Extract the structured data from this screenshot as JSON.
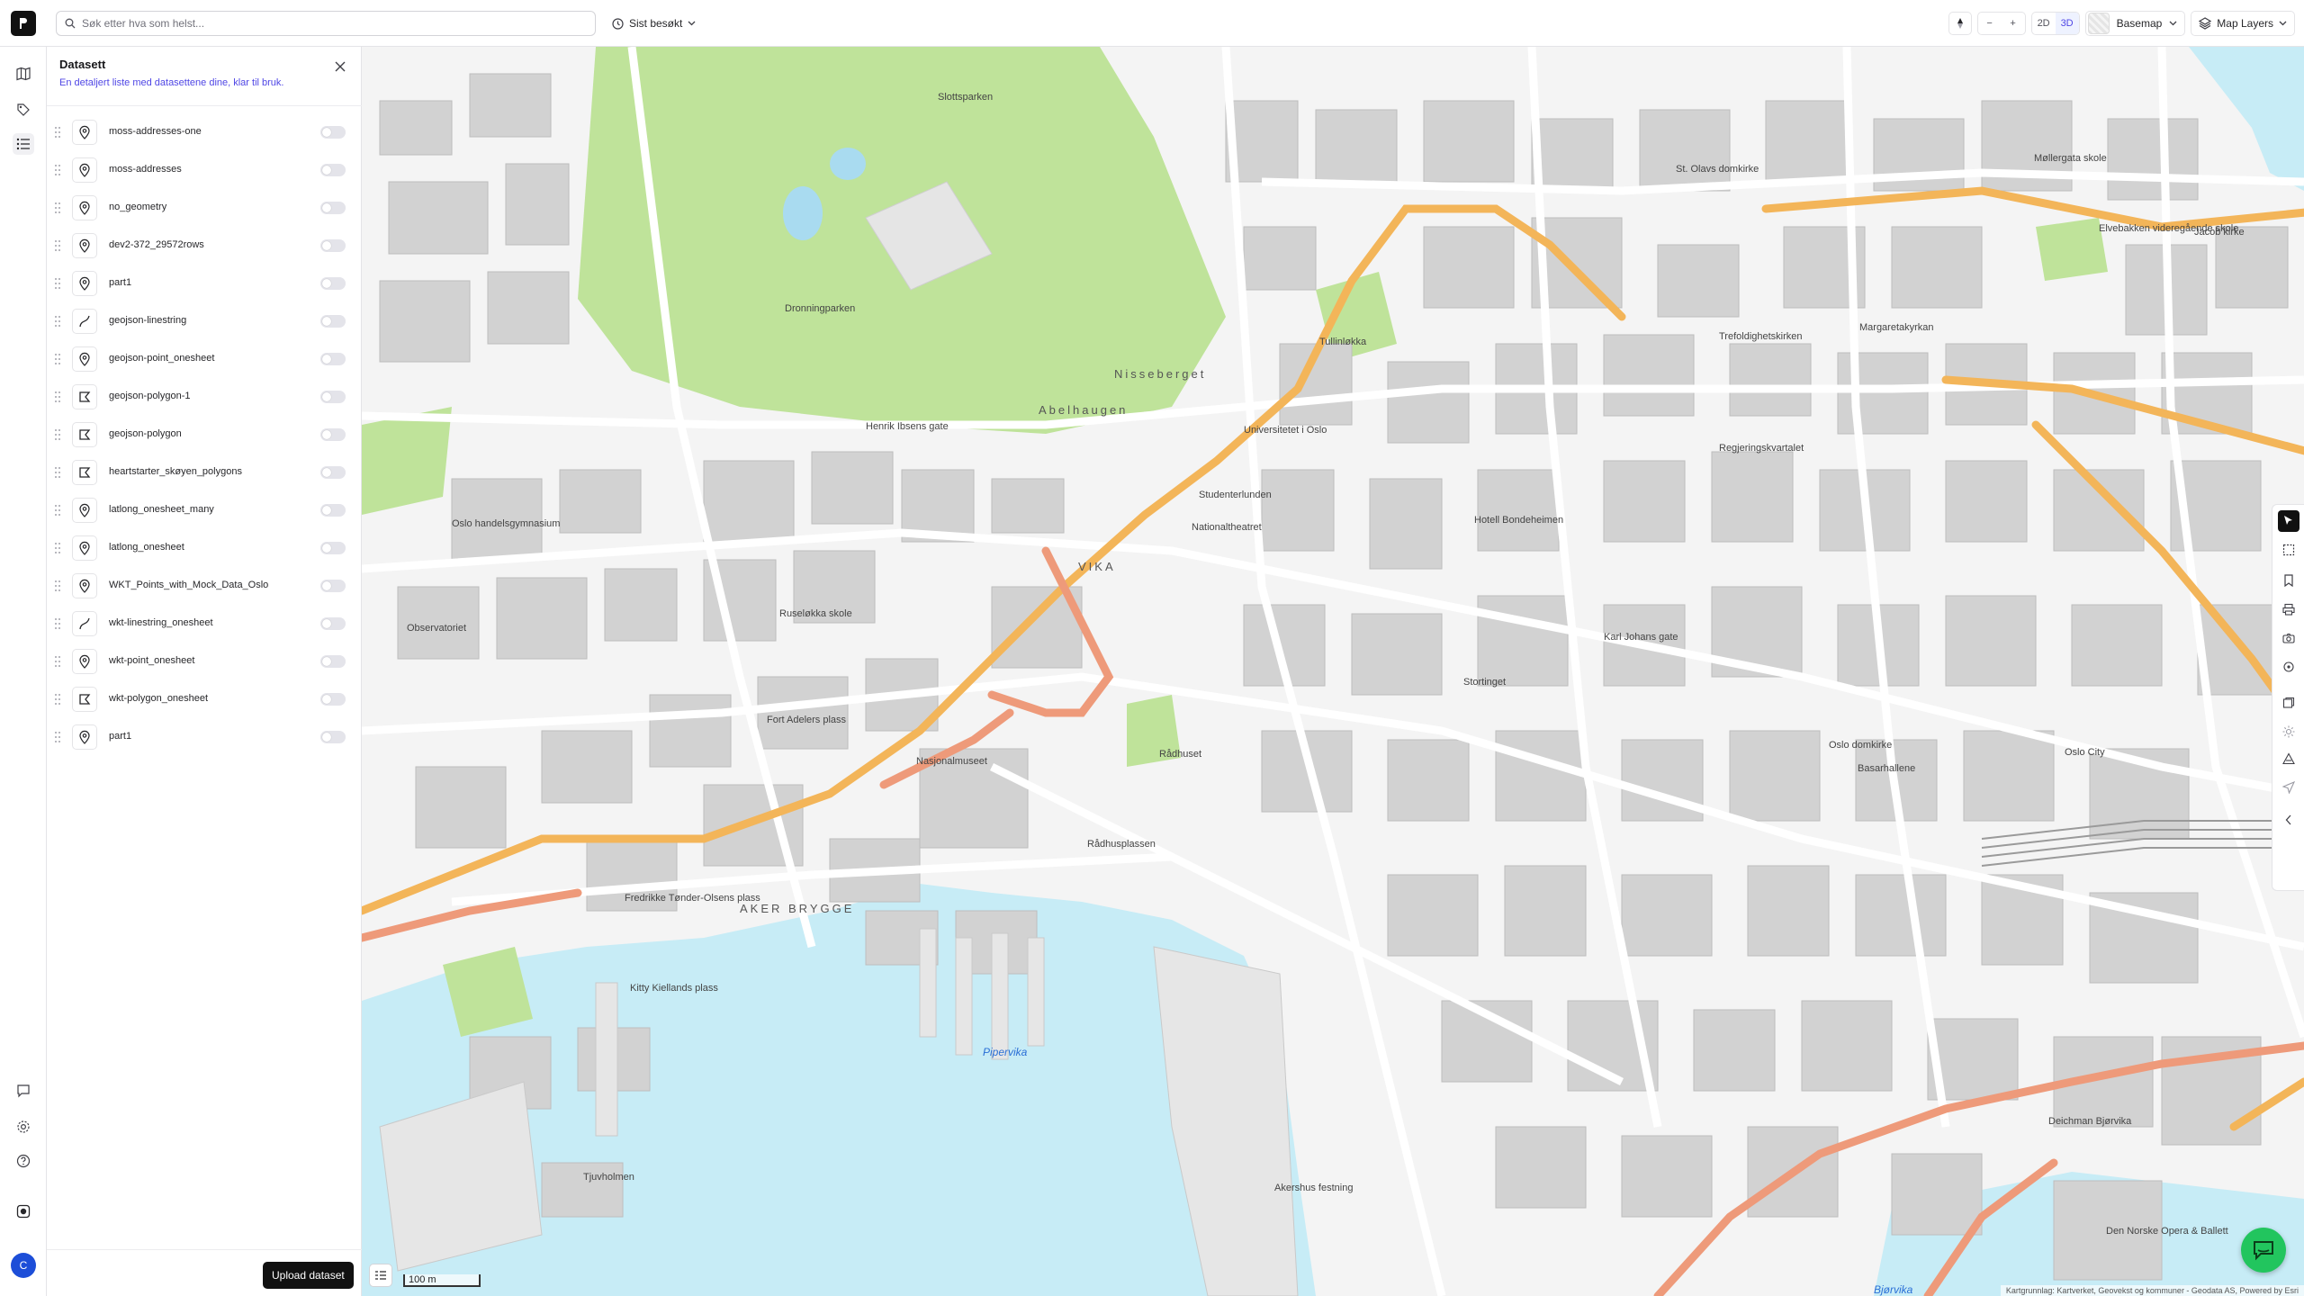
{
  "topbar": {
    "search_placeholder": "Søk etter hva som helst...",
    "recent_label": "Sist besøkt",
    "mode_2d": "2D",
    "mode_3d": "3D",
    "zoom_out": "−",
    "zoom_in": "+",
    "basemap_label": "Basemap",
    "layers_label": "Map Layers"
  },
  "rail": {
    "avatar_initial": "C"
  },
  "panel": {
    "title": "Datasett",
    "subtitle": "En detaljert liste med datasettene dine, klar til bruk.",
    "upload_label": "Upload dataset",
    "datasets": [
      {
        "name": "moss-addresses-one",
        "icon": "point-icon"
      },
      {
        "name": "moss-addresses",
        "icon": "point-icon"
      },
      {
        "name": "no_geometry",
        "icon": "point-icon"
      },
      {
        "name": "dev2-372_29572rows",
        "icon": "point-icon"
      },
      {
        "name": "part1",
        "icon": "point-icon"
      },
      {
        "name": "geojson-linestring",
        "icon": "line-icon"
      },
      {
        "name": "geojson-point_onesheet",
        "icon": "point-icon"
      },
      {
        "name": "geojson-polygon-1",
        "icon": "polygon-icon"
      },
      {
        "name": "geojson-polygon",
        "icon": "polygon-icon"
      },
      {
        "name": "heartstarter_skøyen_polygons",
        "icon": "polygon-icon"
      },
      {
        "name": "latlong_onesheet_many",
        "icon": "point-icon"
      },
      {
        "name": "latlong_onesheet",
        "icon": "point-icon"
      },
      {
        "name": "WKT_Points_with_Mock_Data_Oslo",
        "icon": "point-icon"
      },
      {
        "name": "wkt-linestring_onesheet",
        "icon": "line-icon"
      },
      {
        "name": "wkt-point_onesheet",
        "icon": "point-icon"
      },
      {
        "name": "wkt-polygon_onesheet",
        "icon": "polygon-icon"
      },
      {
        "name": "part1",
        "icon": "point-icon"
      }
    ]
  },
  "map": {
    "scale_label": "100 m",
    "attribution": "Kartgrunnlag: Kartverket, Geovekst og kommuner - Geodata AS, Powered by Esri",
    "labels": [
      "Slottsparken",
      "Dronningparken",
      "Nisseberget",
      "Abelhaugen",
      "Universitetet i Oslo",
      "Tullinløkka",
      "Regjeringskvartalet",
      "Hotell Bondeheimen",
      "Nationaltheatret",
      "Studenterlunden",
      "Stortinget",
      "Oslo domkirke",
      "Basarhallene",
      "Oslo City",
      "Rådhuset",
      "Nasjonalmuseet",
      "Fort Adelers plass",
      "Ruseløkka skole",
      "Observatoriet",
      "Oslo handelsgymnasium",
      "VIKA",
      "AKER BRYGGE",
      "Kitty Kiellands plass",
      "Fredrikke Tønder-Olsens plass",
      "Pipervika",
      "Akershus festning",
      "Tjuvholmen",
      "Den Norske Opera & Ballett",
      "Deichman Bjørvika",
      "Bjørvika",
      "Trefoldighetskirken",
      "Margaretakyrkan",
      "St. Olavs domkirke",
      "Elvebakken videregående skole",
      "Jacob kirke",
      "Møllergata skole",
      "Henrik Ibsens gate",
      "Rådhusplassen",
      "Karl Johans gate"
    ]
  }
}
